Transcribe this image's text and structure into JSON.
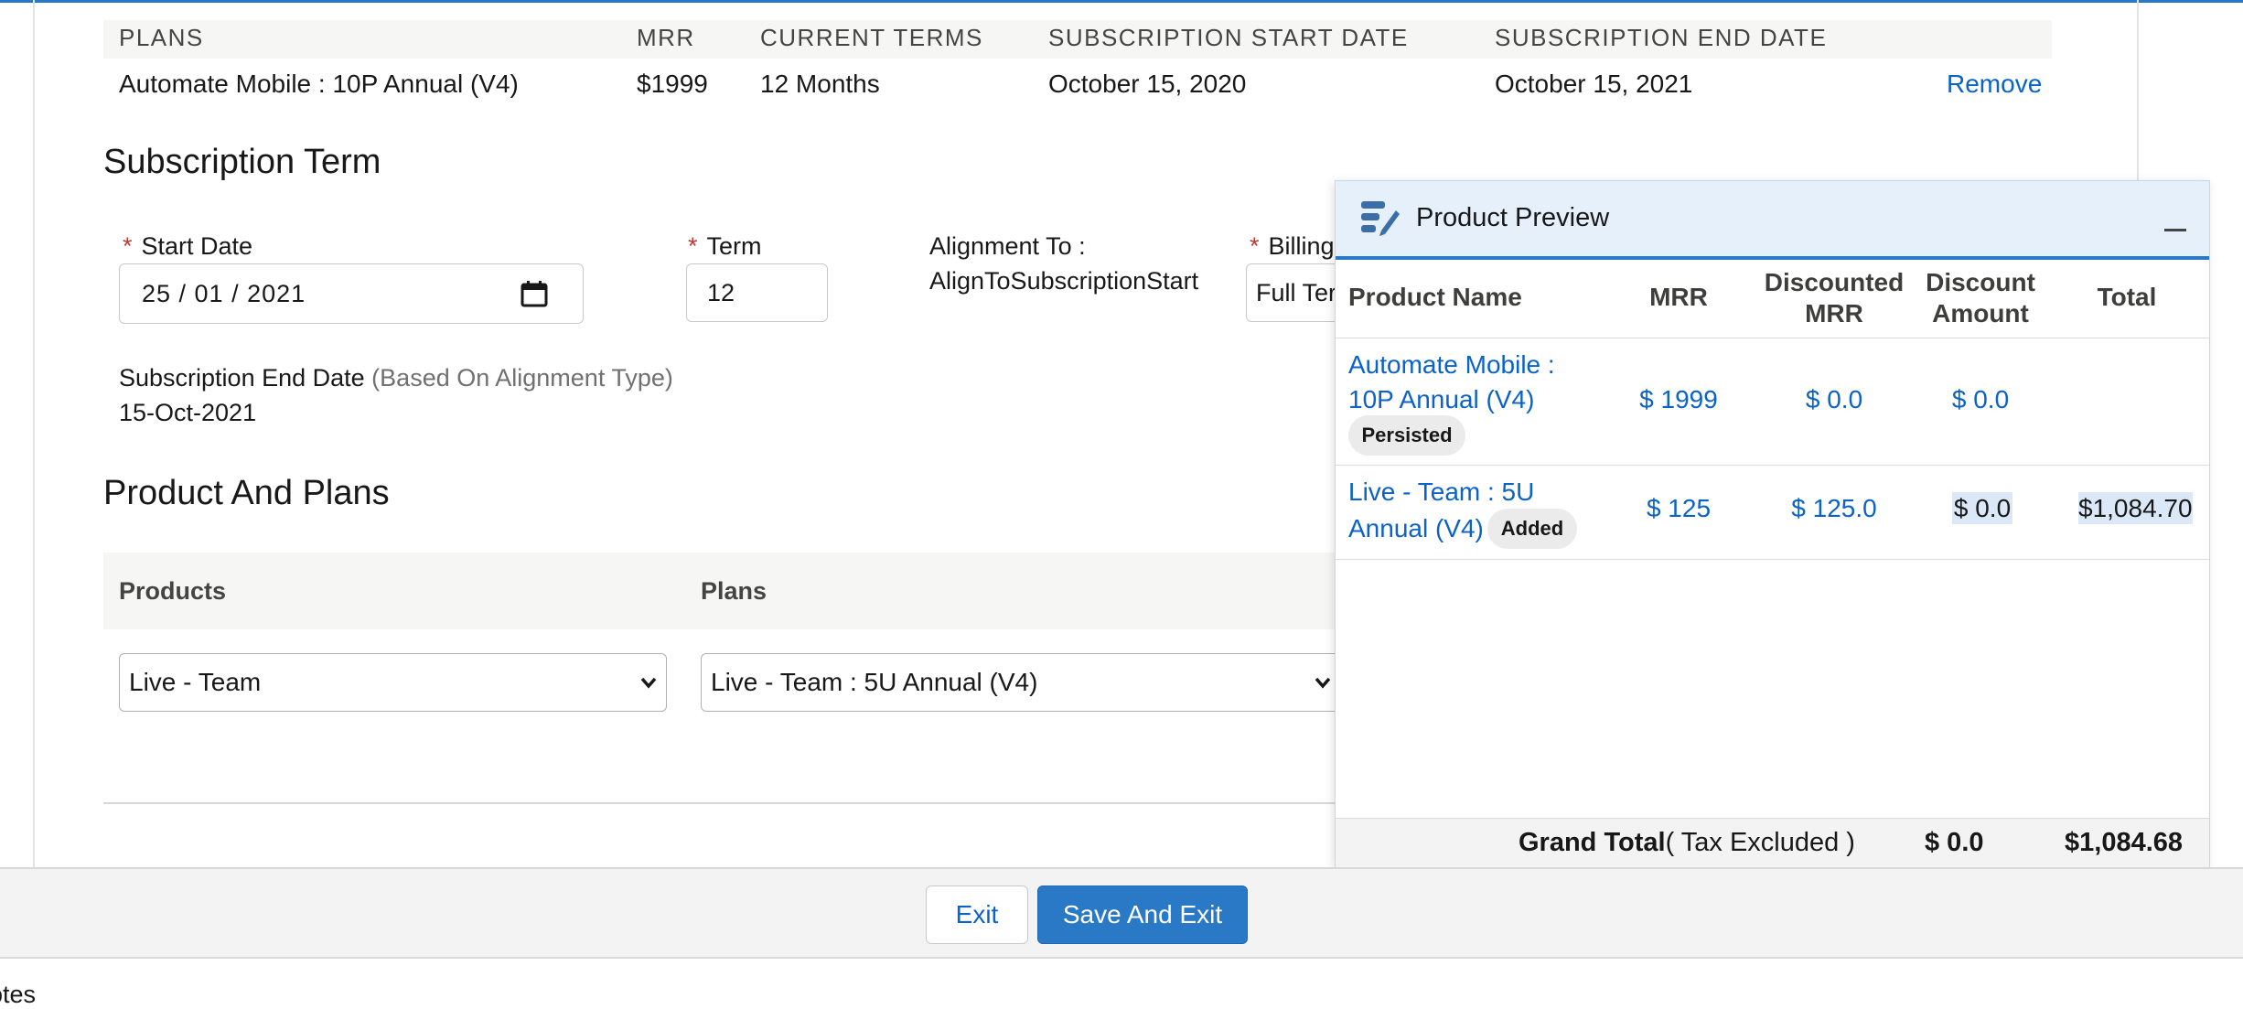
{
  "plans_table": {
    "headers": [
      "PLANS",
      "MRR",
      "CURRENT TERMS",
      "SUBSCRIPTION START DATE",
      "SUBSCRIPTION END DATE"
    ],
    "row": {
      "plan": "Automate Mobile : 10P Annual (V4)",
      "mrr": "$1999",
      "terms": "12 Months",
      "start": "October 15, 2020",
      "end": "October 15, 2021",
      "action": "Remove"
    }
  },
  "subscription_term": {
    "title": "Subscription Term",
    "start_date_label": "Start Date",
    "start_date_value": "25 / 01 / 2021",
    "term_label": "Term",
    "term_value": "12",
    "alignment_label": "Alignment To :",
    "alignment_value": "AlignToSubscriptionStart",
    "billing_label": "Billing",
    "billing_value": "Full Ter",
    "end_date_label": "Subscription End Date",
    "end_date_hint": "(Based On Alignment Type)",
    "end_date_value": "15-Oct-2021"
  },
  "product_plans": {
    "title": "Product And Plans",
    "products_header": "Products",
    "plans_header": "Plans",
    "product_selected": "Live - Team",
    "plan_selected": "Live - Team : 5U Annual (V4)"
  },
  "preview": {
    "title": "Product Preview",
    "headers": {
      "name": "Product Name",
      "mrr": "MRR",
      "discounted_mrr_1": "Discounted",
      "discounted_mrr_2": "MRR",
      "discount_amount_1": "Discount",
      "discount_amount_2": "Amount",
      "total": "Total"
    },
    "rows": [
      {
        "name_line1": "Automate Mobile :",
        "name_line2": "10P Annual (V4)",
        "badge": "Persisted",
        "mrr": "$ 1999",
        "discounted_mrr": "$ 0.0",
        "discount_amount": "$ 0.0",
        "total": ""
      },
      {
        "name_line1": "Live - Team : 5U",
        "name_line2": "Annual (V4)",
        "badge": "Added",
        "mrr": "$ 125",
        "discounted_mrr": "$ 125.0",
        "discount_amount": "$ 0.0",
        "total": "$1,084.70"
      }
    ],
    "grand_total_label": "Grand Total",
    "grand_total_note": "( Tax Excluded )",
    "grand_discount": "$ 0.0",
    "grand_total": "$1,084.68"
  },
  "footer": {
    "exit_label": "Exit",
    "save_label": "Save And Exit"
  },
  "notes_label": "otes"
}
